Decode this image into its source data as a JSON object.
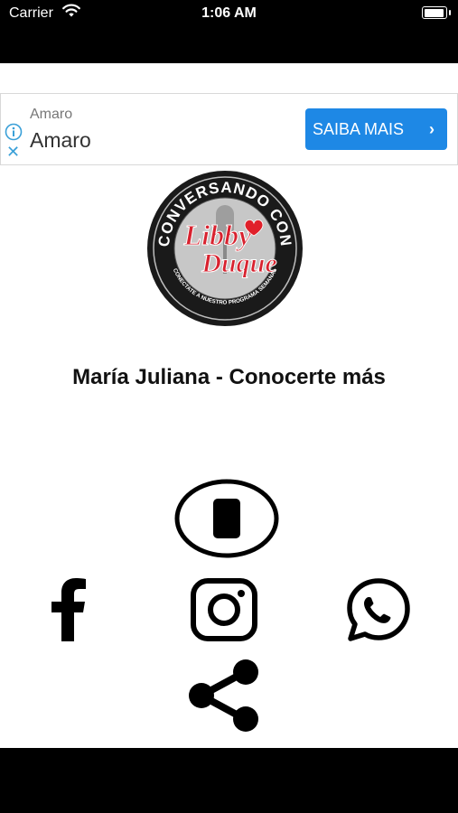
{
  "status_bar": {
    "carrier": "Carrier",
    "time": "1:06 AM"
  },
  "ad": {
    "small_text": "Amaro",
    "title": "Amaro",
    "cta_label": "SAIBA MAIS"
  },
  "logo": {
    "top_text": "CONVERSANDO CON",
    "script_line1": "Libby",
    "script_line2": "Duque",
    "bottom_text": "CONECTATE A NUESTRO PROGRAMA SEMANAL",
    "colors": {
      "ring": "#1a1a1a",
      "script": "#d8222f",
      "heart": "#e0202a"
    }
  },
  "player": {
    "title": "María Juliana - Conocerte más",
    "control_icon": "stop-icon"
  },
  "social": {
    "icons": [
      "facebook-icon",
      "instagram-icon",
      "whatsapp-icon",
      "share-icon"
    ]
  }
}
